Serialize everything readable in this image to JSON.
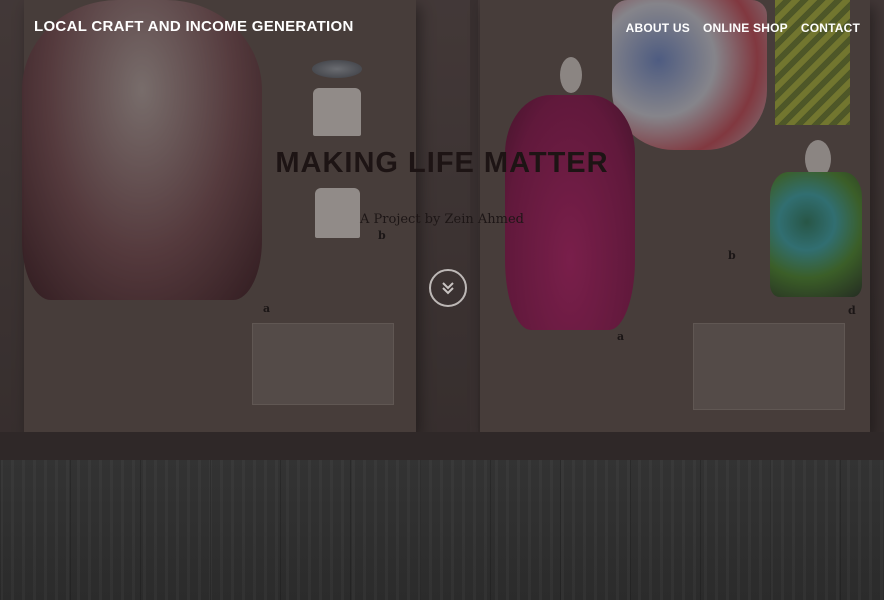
{
  "site": {
    "brand": "LOCAL CRAFT AND INCOME GENERATION"
  },
  "nav": {
    "items": [
      {
        "label": "ABOUT US"
      },
      {
        "label": "ONLINE SHOP"
      },
      {
        "label": "CONTACT"
      }
    ]
  },
  "hero": {
    "title": "MAKING LIFE MATTER",
    "subtitle": "A Project by Zein Ahmed",
    "scroll_icon": "double-chevron-down-icon",
    "exhibit_tags": [
      "b",
      "a",
      "a",
      "b",
      "d"
    ]
  },
  "colors": {
    "text_light": "#ffffff",
    "headline": "#1d1414",
    "scroll_ring": "#bdb8b6",
    "wood": "#2f2f2f"
  }
}
